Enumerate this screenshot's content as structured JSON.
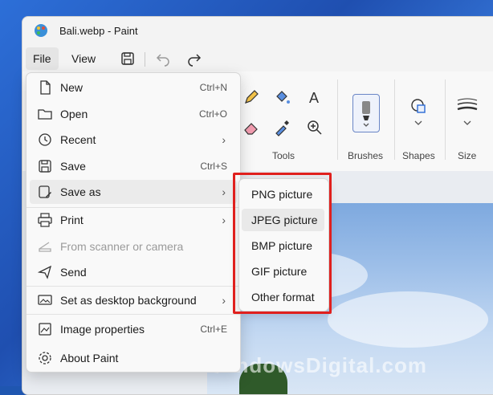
{
  "window": {
    "title": "Bali.webp - Paint"
  },
  "menubar": {
    "file_label": "File",
    "view_label": "View"
  },
  "ribbon": {
    "groups": {
      "tools": "Tools",
      "brushes": "Brushes",
      "shapes": "Shapes",
      "size": "Size"
    },
    "text_tool_glyph": "A"
  },
  "file_menu": {
    "items": [
      {
        "label": "New",
        "shortcut": "Ctrl+N",
        "icon": "new-file-icon"
      },
      {
        "label": "Open",
        "shortcut": "Ctrl+O",
        "icon": "folder-icon"
      },
      {
        "label": "Recent",
        "shortcut": "",
        "icon": "clock-icon",
        "submenu": true
      },
      {
        "label": "Save",
        "shortcut": "Ctrl+S",
        "icon": "save-icon"
      },
      {
        "label": "Save as",
        "shortcut": "",
        "icon": "save-as-icon",
        "submenu": true,
        "highlighted": true
      },
      {
        "label": "Print",
        "shortcut": "",
        "icon": "printer-icon",
        "submenu": true
      },
      {
        "label": "From scanner or camera",
        "shortcut": "",
        "icon": "scanner-icon",
        "disabled": true
      },
      {
        "label": "Send",
        "shortcut": "",
        "icon": "send-icon"
      },
      {
        "label": "Set as desktop background",
        "shortcut": "",
        "icon": "desktop-background-icon",
        "submenu": true
      },
      {
        "label": "Image properties",
        "shortcut": "Ctrl+E",
        "icon": "image-properties-icon"
      },
      {
        "label": "About Paint",
        "shortcut": "",
        "icon": "gear-icon"
      }
    ]
  },
  "save_as_submenu": {
    "items": [
      {
        "label": "PNG picture"
      },
      {
        "label": "JPEG picture",
        "highlighted": true
      },
      {
        "label": "BMP picture"
      },
      {
        "label": "GIF picture"
      },
      {
        "label": "Other format"
      }
    ]
  },
  "watermark": {
    "text": "WindowsDigital.com"
  },
  "colors": {
    "highlight_border": "#e0201e",
    "menu_bg": "#f9f9f9",
    "brush_selected": "#6a86c6"
  }
}
